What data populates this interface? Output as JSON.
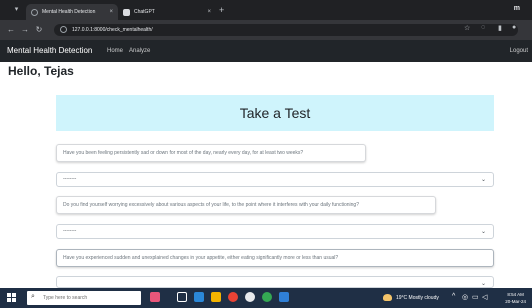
{
  "browser": {
    "tabs": [
      {
        "title": "Mental Health Detection"
      },
      {
        "title": "ChatGPT"
      }
    ],
    "url": "127.0.0.1:8000/check_mentalhealth/",
    "window_control": "m"
  },
  "app": {
    "brand": "Mental Health Detection",
    "nav": [
      {
        "label": "Home"
      },
      {
        "label": "Analyze"
      }
    ],
    "logout": "Logout"
  },
  "page": {
    "greeting": "Hello, Tejas",
    "test_title": "Take a Test",
    "questions": [
      {
        "text": "Have you been feeling persistently sad or down for most of the day, nearly every day, for at least two weeks?",
        "selected": "--------"
      },
      {
        "text": "Do you find yourself worrying excessively about various aspects of your life, to the point where it interferes with your daily functioning?",
        "selected": "--------"
      },
      {
        "text": "Have you experienced sudden and unexplained changes in your appetite, either eating significantly more or less than usual?",
        "selected": ""
      }
    ]
  },
  "taskbar": {
    "search_placeholder": "Type here to search",
    "weather": "19°C  Mostly cloudy",
    "time": "8:54 AM",
    "date": "20-Mar-24"
  },
  "colors": {
    "app_navbar": "#212529",
    "test_card": "#cff4fc",
    "browser_chrome": "#35363a",
    "taskbar": "#1f2f45"
  }
}
